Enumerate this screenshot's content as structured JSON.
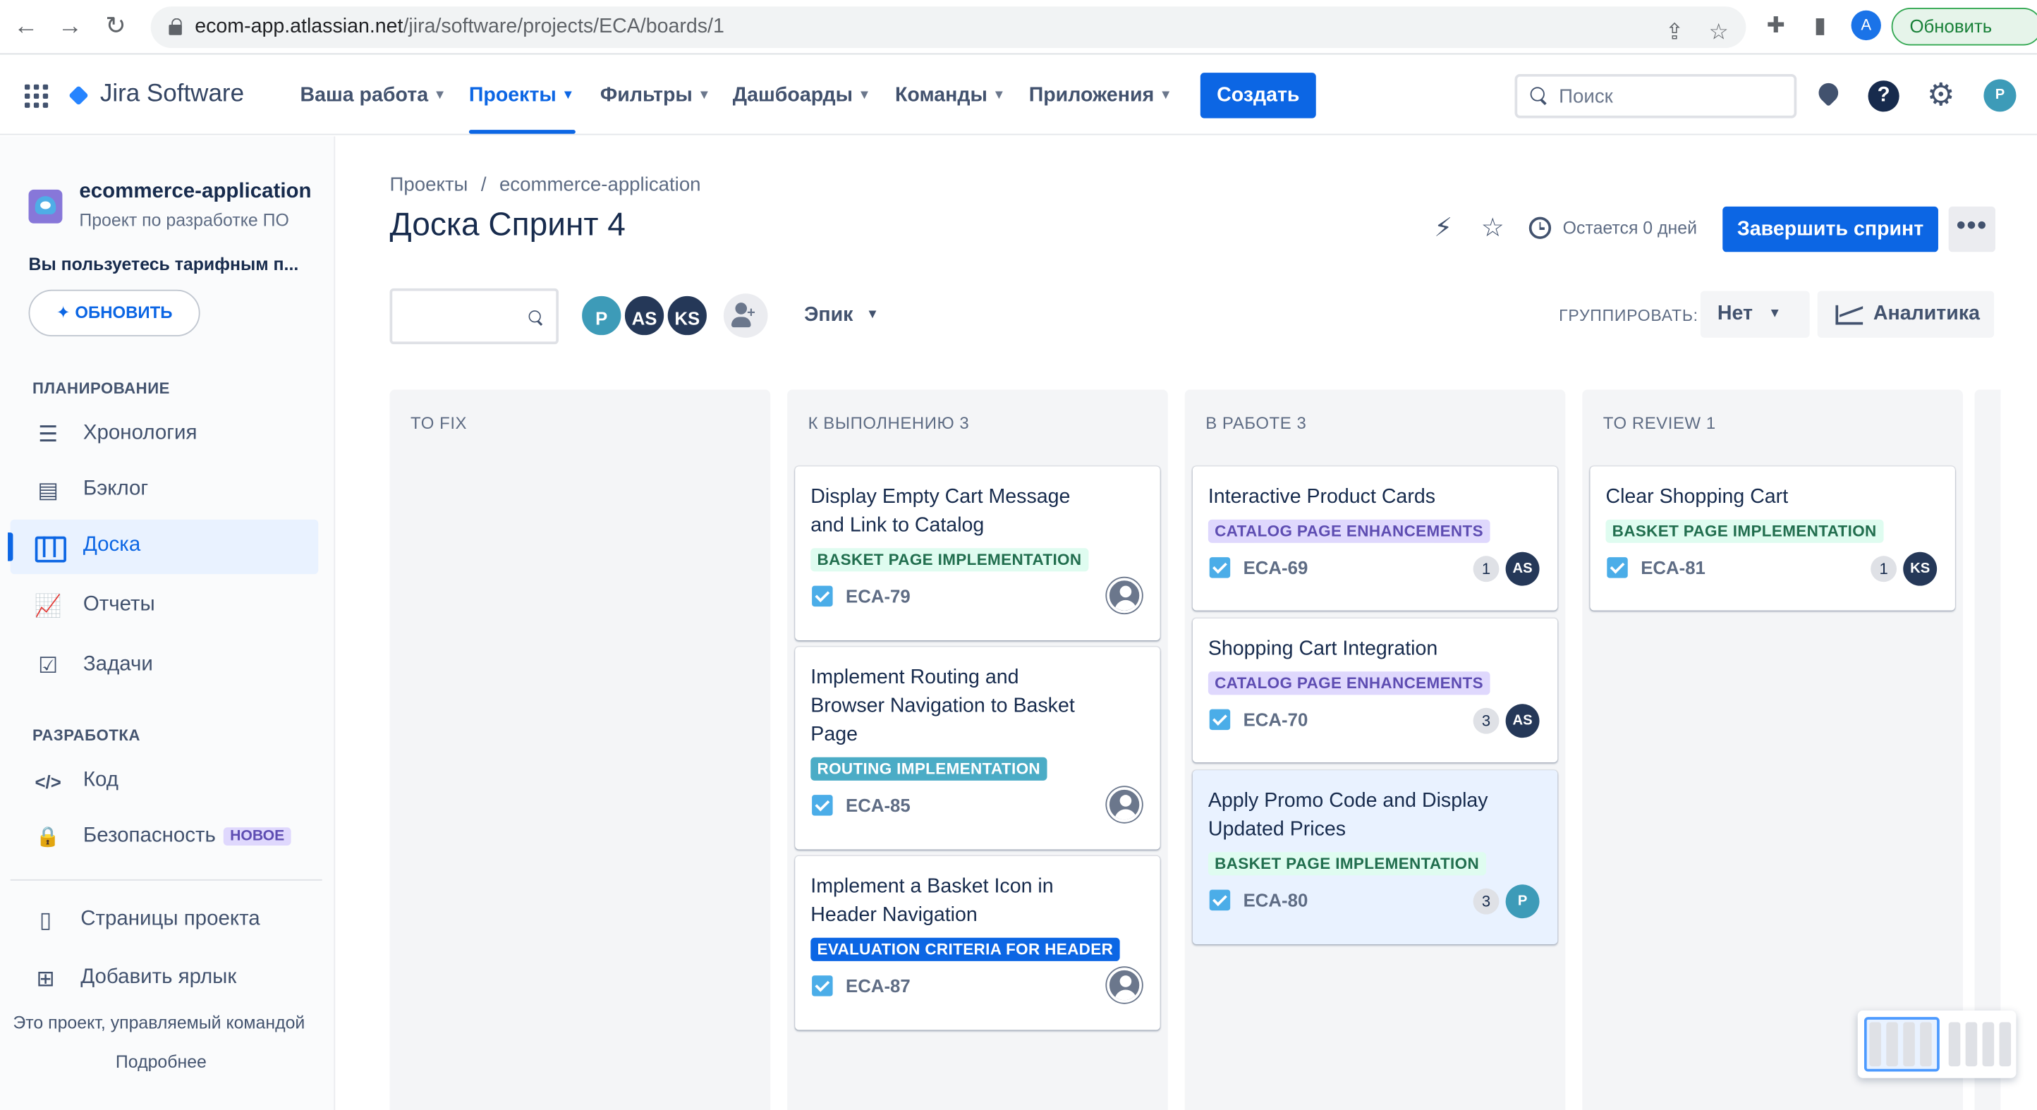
{
  "browser": {
    "url_host": "ecom-app.atlassian.net",
    "url_path": "/jira/software/projects/ECA/boards/1",
    "avatar_letter": "A",
    "update_label": "Обновить",
    "back_glyph": "←",
    "forward_glyph": "→",
    "reload_glyph": "↻",
    "share_glyph": "⇪",
    "star_glyph": "☆",
    "extensions_glyph": "✚",
    "sidepanel_glyph": "▮"
  },
  "header": {
    "app_name": "Jira Software",
    "nav": [
      {
        "label": "Ваша работа",
        "active": false
      },
      {
        "label": "Проекты",
        "active": true
      },
      {
        "label": "Фильтры",
        "active": false
      },
      {
        "label": "Дашбоарды",
        "active": false
      },
      {
        "label": "Команды",
        "active": false
      },
      {
        "label": "Приложения",
        "active": false
      }
    ],
    "create_label": "Создать",
    "search_placeholder": "Поиск",
    "help_glyph": "?",
    "settings_glyph": "⚙",
    "user_initial": "P"
  },
  "sidebar": {
    "project_name": "ecommerce-application",
    "project_type": "Проект по разработке ПО",
    "plan_note": "Вы пользуетесь тарифным п...",
    "upgrade_label": "✦ ОБНОВИТЬ",
    "planning_title": "ПЛАНИРОВАНИЕ",
    "planning_items": [
      {
        "label": "Хронология",
        "icon": "timeline-icon",
        "glyph": "☰"
      },
      {
        "label": "Бэклог",
        "icon": "backlog-icon",
        "glyph": "▤"
      },
      {
        "label": "Доска",
        "icon": "board-icon",
        "glyph": ""
      },
      {
        "label": "Отчеты",
        "icon": "reports-icon",
        "glyph": "📈"
      },
      {
        "label": "Задачи",
        "icon": "issues-icon",
        "glyph": "☑"
      }
    ],
    "dev_title": "РАЗРАБОТКА",
    "dev_items": [
      {
        "label": "Код",
        "icon": "code-icon",
        "glyph": "</>"
      },
      {
        "label": "Безопасность",
        "icon": "lock-icon",
        "glyph": "🔒",
        "badge": "НОВОЕ"
      }
    ],
    "extra_items": [
      {
        "label": "Страницы проекта",
        "icon": "pages-icon",
        "glyph": "▯"
      },
      {
        "label": "Добавить ярлык",
        "icon": "add-shortcut-icon",
        "glyph": "⊞"
      }
    ],
    "footer_text": "Это проект, управляемый командой",
    "footer_link": "Подробнее"
  },
  "board": {
    "breadcrumb": [
      "Проекты",
      "ecommerce-application"
    ],
    "breadcrumb_sep": "/",
    "title": "Доска Спринт 4",
    "lightning_glyph": "⚡",
    "star_glyph": "☆",
    "remaining": "Остается 0 дней",
    "complete_label": "Завершить спринт",
    "more_label": "•••",
    "assignees": [
      {
        "initials": "P",
        "color": "#3d9bb8"
      },
      {
        "initials": "AS",
        "color": "#253858"
      },
      {
        "initials": "KS",
        "color": "#253858"
      }
    ],
    "add_glyph": "+",
    "epic_label": "Эпик",
    "group_label": "ГРУППИРОВАТЬ:",
    "group_value": "Нет",
    "analytics_label": "Аналитика",
    "colors": {
      "primary": "#0c66e4",
      "card_highlight": "#e9f2ff",
      "column_bg": "#f4f5f7"
    }
  },
  "columns": [
    {
      "title": "TO FIX",
      "cards": []
    },
    {
      "title": "К ВЫПОЛНЕНИЮ 3",
      "cards": [
        {
          "title": "Display Empty Cart Message and Link to Catalog",
          "epic": "BASKET PAGE IMPLEMENTATION",
          "epic_style": "green",
          "key": "ECA-79",
          "estimate": "",
          "assignee": "",
          "highlight": false
        },
        {
          "title": "Implement Routing and Browser Navigation to Basket Page",
          "epic": "ROUTING IMPLEMENTATION",
          "epic_style": "teal",
          "key": "ECA-85",
          "estimate": "",
          "assignee": "",
          "highlight": false
        },
        {
          "title": "Implement a Basket Icon in Header Navigation",
          "epic": "EVALUATION CRITERIA FOR HEADER",
          "epic_style": "blue",
          "key": "ECA-87",
          "estimate": "",
          "assignee": "",
          "highlight": false
        }
      ]
    },
    {
      "title": "В РАБОТЕ 3",
      "cards": [
        {
          "title": "Interactive Product Cards",
          "epic": "CATALOG PAGE ENHANCEMENTS",
          "epic_style": "purple",
          "key": "ECA-69",
          "estimate": "1",
          "assignee": "AS",
          "highlight": false
        },
        {
          "title": "Shopping Cart Integration",
          "epic": "CATALOG PAGE ENHANCEMENTS",
          "epic_style": "purple",
          "key": "ECA-70",
          "estimate": "3",
          "assignee": "AS",
          "highlight": false
        },
        {
          "title": "Apply Promo Code and Display Updated Prices",
          "epic": "BASKET PAGE IMPLEMENTATION",
          "epic_style": "green",
          "key": "ECA-80",
          "estimate": "3",
          "assignee": "P",
          "highlight": true
        }
      ]
    },
    {
      "title": "TO REVIEW 1",
      "cards": [
        {
          "title": "Clear Shopping Cart",
          "epic": "BASKET PAGE IMPLEMENTATION",
          "epic_style": "green",
          "key": "ECA-81",
          "estimate": "1",
          "assignee": "KS",
          "highlight": false
        }
      ]
    }
  ]
}
